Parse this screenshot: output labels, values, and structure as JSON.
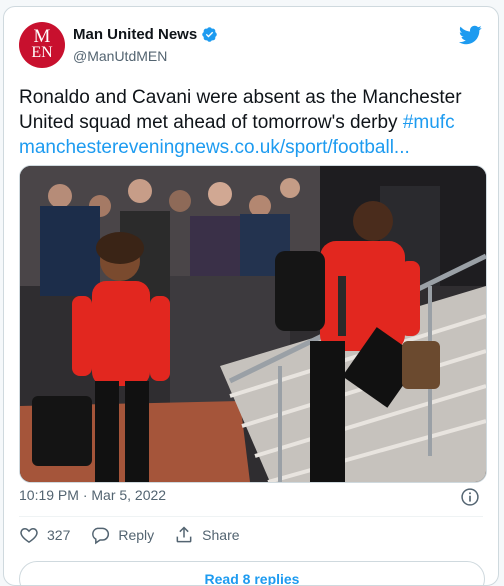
{
  "author": {
    "display_name": "Man United News",
    "handle": "@ManUtdMEN",
    "avatar_text_top": "M",
    "avatar_text_bottom": "EN",
    "verified": true
  },
  "tweet": {
    "text": "Ronaldo and Cavani were absent as the Manchester United squad met ahead of tomorrow's derby ",
    "hashtag": "#mufc",
    "link": "manchestereveningnews.co.uk/sport/football..."
  },
  "media": {
    "kind": "photo",
    "subject": "players-boarding-train"
  },
  "meta": {
    "timestamp": "10:19 PM · Mar 5, 2022"
  },
  "actions": {
    "like_count": "327",
    "reply_label": "Reply",
    "share_label": "Share"
  },
  "read_replies_label": "Read 8 replies",
  "colors": {
    "accent": "#1d9bf0",
    "avatar_bg": "#c8102e",
    "text": "#0f1419",
    "muted": "#536471"
  }
}
